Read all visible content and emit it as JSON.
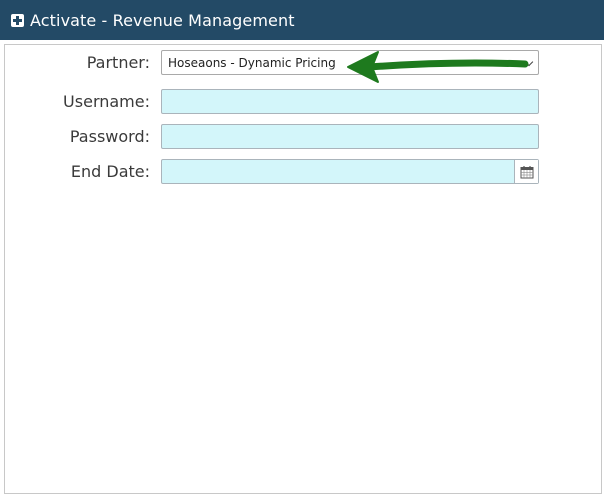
{
  "window": {
    "title": "Activate - Revenue Management"
  },
  "form": {
    "partner": {
      "label": "Partner:",
      "selected": "Hoseaons - Dynamic Pricing"
    },
    "username": {
      "label": "Username:",
      "value": ""
    },
    "password": {
      "label": "Password:",
      "value": ""
    },
    "end_date": {
      "label": "End Date:",
      "value": ""
    }
  },
  "colors": {
    "titlebar": "#234a66",
    "input_bg": "#d3f6fa",
    "annotation_arrow": "#1e7a1e"
  },
  "icons": {
    "title": "expand-plus-icon",
    "partner_select": "chevron-down-icon",
    "end_date": "calendar-icon",
    "annotation": "green-arrow-annotation"
  }
}
